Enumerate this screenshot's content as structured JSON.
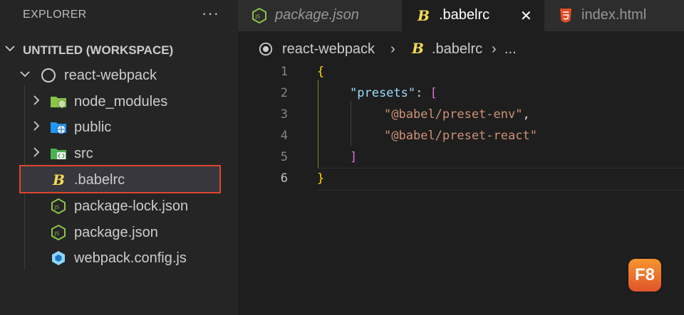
{
  "sidebar": {
    "title": "EXPLORER",
    "more_label": "···",
    "workspace_label": "UNTITLED (WORKSPACE)",
    "project_label": "react-webpack",
    "items": [
      {
        "label": "node_modules",
        "icon": "node-folder-icon"
      },
      {
        "label": "public",
        "icon": "public-folder-icon"
      },
      {
        "label": "src",
        "icon": "src-folder-icon"
      },
      {
        "label": ".babelrc",
        "icon": "babel-icon"
      },
      {
        "label": "package-lock.json",
        "icon": "node-js-icon"
      },
      {
        "label": "package.json",
        "icon": "node-js-icon"
      },
      {
        "label": "webpack.config.js",
        "icon": "webpack-icon"
      }
    ]
  },
  "tabs": [
    {
      "label": "package.json",
      "icon": "node-js-icon"
    },
    {
      "label": ".babelrc",
      "icon": "babel-icon",
      "close": "✕"
    },
    {
      "label": "index.html",
      "icon": "html5-icon"
    }
  ],
  "breadcrumb": {
    "folder": "react-webpack",
    "sep1": "›",
    "file": ".babelrc",
    "sep2": "›",
    "more": "..."
  },
  "editor": {
    "line_numbers": [
      "1",
      "2",
      "3",
      "4",
      "5",
      "6"
    ],
    "open_brace": "{",
    "key": "\"presets\"",
    "colon": ": ",
    "open_bracket": "[",
    "item1": "\"@babel/preset-env\"",
    "comma": ",",
    "item2": "\"@babel/preset-react\"",
    "close_bracket": "]",
    "close_brace": "}"
  },
  "badge": {
    "label": "F8"
  },
  "colors": {
    "selection_outline": "#e0452c",
    "brace": "#ffd700",
    "bracket": "#da70d6",
    "key": "#9cdcfe",
    "string": "#ce9178"
  }
}
